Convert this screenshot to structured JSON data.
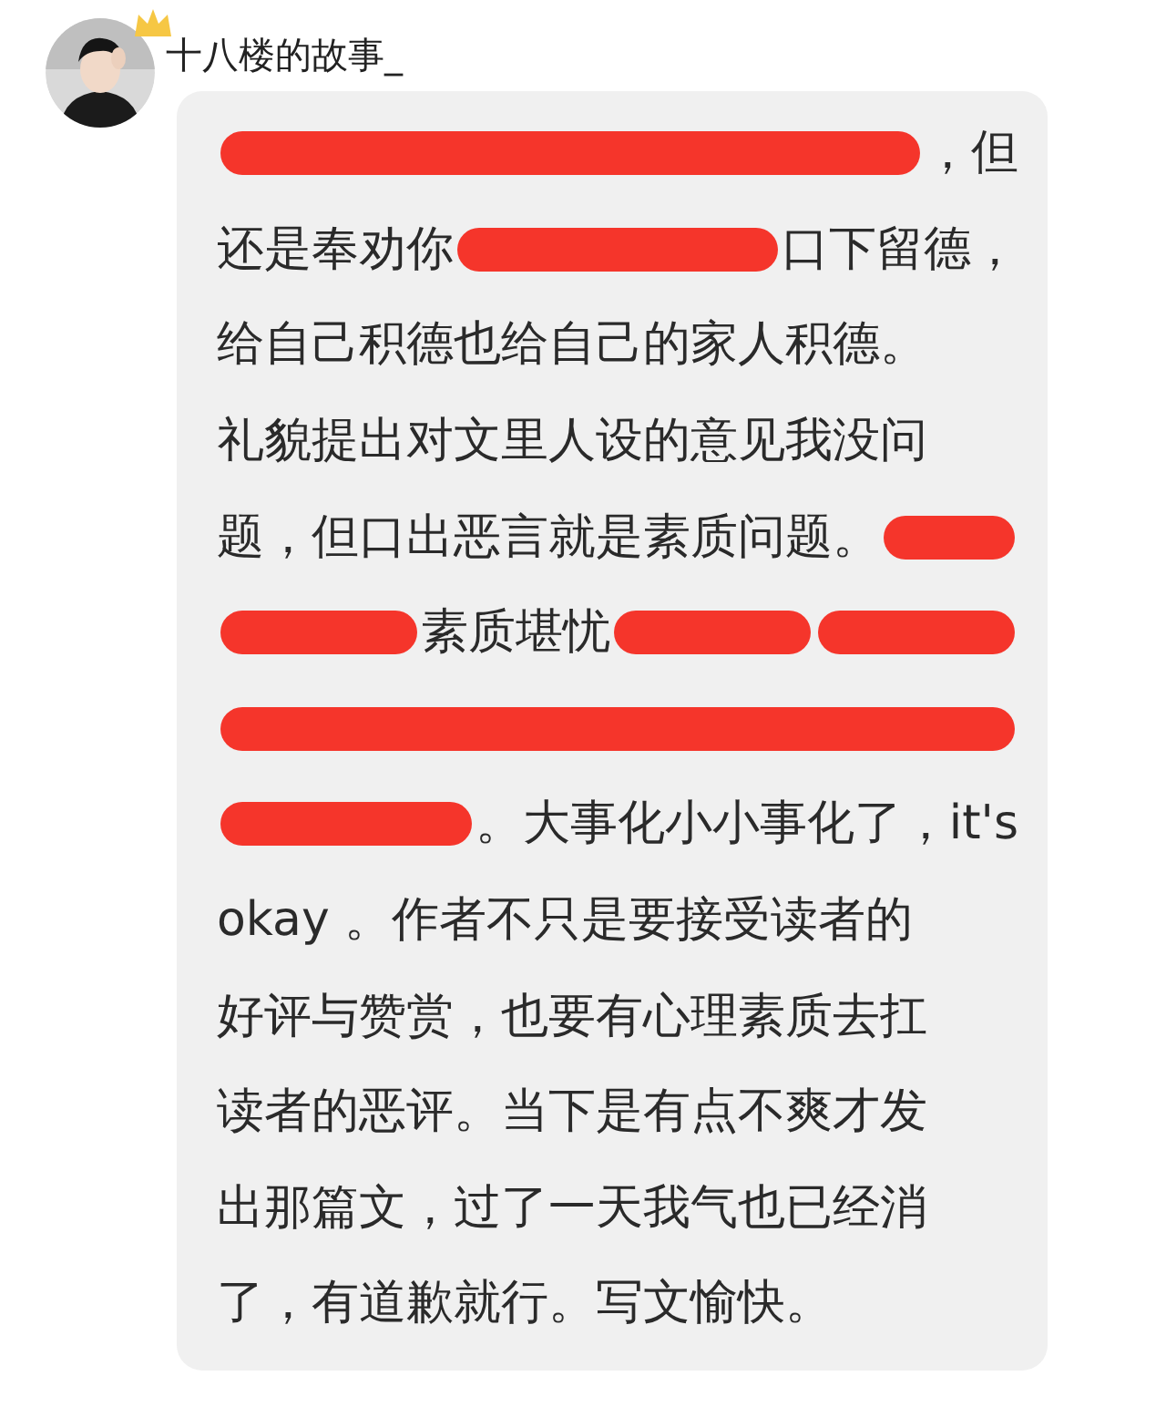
{
  "comment": {
    "username": "十八楼的故事_",
    "lines": [
      {
        "segments": [
          {
            "kind": "redaction"
          },
          {
            "kind": "text",
            "text": "，但"
          }
        ]
      },
      {
        "segments": [
          {
            "kind": "text",
            "text": "还是奉劝你"
          },
          {
            "kind": "redaction"
          },
          {
            "kind": "text",
            "text": "口下留德，"
          }
        ]
      },
      {
        "segments": [
          {
            "kind": "text",
            "text": "给自己积德也给自己的家人积德。"
          }
        ]
      },
      {
        "segments": [
          {
            "kind": "text",
            "text": "礼貌提出对文里人设的意见我没问"
          }
        ]
      },
      {
        "segments": [
          {
            "kind": "text",
            "text": "题，但口出恶言就是素质问题。"
          },
          {
            "kind": "redaction"
          }
        ]
      },
      {
        "segments": [
          {
            "kind": "redaction"
          },
          {
            "kind": "text",
            "text": "素质堪忧"
          },
          {
            "kind": "redaction"
          },
          {
            "kind": "redaction"
          }
        ]
      },
      {
        "segments": [
          {
            "kind": "redaction"
          }
        ]
      },
      {
        "segments": [
          {
            "kind": "redaction"
          },
          {
            "kind": "text",
            "text": "。大事化小小事化了，it's"
          }
        ]
      },
      {
        "segments": [
          {
            "kind": "text",
            "text": "okay 。作者不只是要接受读者的"
          }
        ]
      },
      {
        "segments": [
          {
            "kind": "text",
            "text": "好评与赞赏，也要有心理素质去扛"
          }
        ]
      },
      {
        "segments": [
          {
            "kind": "text",
            "text": "读者的恶评。当下是有点不爽才发"
          }
        ]
      },
      {
        "segments": [
          {
            "kind": "text",
            "text": "出那篇文，过了一天我气也已经消"
          }
        ]
      },
      {
        "segments": [
          {
            "kind": "text",
            "text": "了，有道歉就行。写文愉快。"
          }
        ]
      }
    ]
  }
}
